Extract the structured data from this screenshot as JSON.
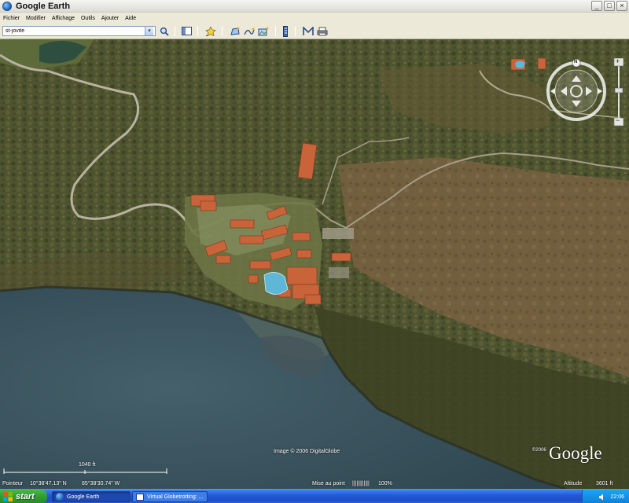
{
  "window": {
    "title": "Google Earth",
    "buttons": {
      "minimize": "_",
      "maximize": "□",
      "close": "×"
    }
  },
  "menu": {
    "items": [
      "Fichier",
      "Modifier",
      "Affichage",
      "Outils",
      "Ajouter",
      "Aide"
    ]
  },
  "toolbar": {
    "search": {
      "value": "st-jovite",
      "placeholder": ""
    },
    "icons": [
      "search-icon",
      "sidebar-toggle-icon",
      "placemark-icon",
      "polygon-icon",
      "path-icon",
      "image-overlay-icon",
      "ruler-icon",
      "email-icon",
      "print-icon"
    ]
  },
  "map": {
    "attribution": "Image © 2006 DigitalGlobe",
    "logo": "Google",
    "logo_year": "©2006",
    "scale_label": "1040 ft",
    "compass_north": "N",
    "zoom_in": "+",
    "zoom_out": "−",
    "status": {
      "pointer_label": "Pointeur",
      "latitude": "10°38'47.13\" N",
      "longitude": "85°38'30.74\" W",
      "streaming_label": "Mise au point",
      "streaming_bars": "||||||||||||",
      "streaming_pct": "100%",
      "altitude_label": "Altitude",
      "altitude": "3601 ft"
    },
    "colors": {
      "sea": "#3e5660",
      "forest": "#4f5531",
      "dry_field": "#7a6547",
      "roof": "#c8633a",
      "pool": "#5fb7d8"
    }
  },
  "taskbar": {
    "start_label": "start",
    "tasks": [
      {
        "label": "Google Earth",
        "active": true
      },
      {
        "label": "Virtual Globetrotting: ...",
        "active": false
      }
    ],
    "clock": "22:06"
  }
}
